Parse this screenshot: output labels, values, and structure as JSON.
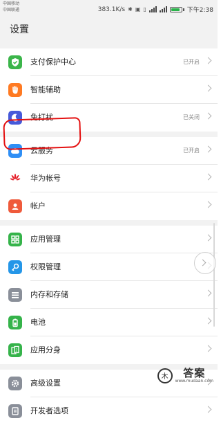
{
  "status_bar": {
    "carrier_1": "中国移动",
    "carrier_2": "中国联通",
    "speed": "383.1K/s",
    "battery_level": 0.8,
    "time": "下午2:38"
  },
  "header": {
    "title": "设置"
  },
  "groups": [
    [
      {
        "label": "支付保护中心",
        "value": "已开启",
        "icon": "shield-check-icon",
        "color": "#3bb54a"
      },
      {
        "label": "智能辅助",
        "value": "",
        "icon": "hand-icon",
        "color": "#ff7a22"
      },
      {
        "label": "免打扰",
        "value": "已关闭",
        "icon": "moon-icon",
        "color": "#4659d9"
      }
    ],
    [
      {
        "label": "云服务",
        "value": "已开启",
        "icon": "cloud-icon",
        "color": "#2f8ff5"
      },
      {
        "label": "华为帐号",
        "value": "",
        "icon": "huawei-logo-icon",
        "color": "#ffffff"
      },
      {
        "label": "帐户",
        "value": "",
        "icon": "account-icon",
        "color": "#ef5a3b"
      }
    ],
    [
      {
        "label": "应用管理",
        "value": "",
        "icon": "app-grid-icon",
        "color": "#35b34a"
      },
      {
        "label": "权限管理",
        "value": "",
        "icon": "key-icon",
        "color": "#2496e8"
      },
      {
        "label": "内存和存储",
        "value": "",
        "icon": "storage-icon",
        "color": "#8a8f99"
      },
      {
        "label": "电池",
        "value": "",
        "icon": "battery-icon",
        "color": "#35b34a"
      },
      {
        "label": "应用分身",
        "value": "",
        "icon": "app-twin-icon",
        "color": "#35b34a"
      }
    ],
    [
      {
        "label": "高级设置",
        "value": "",
        "icon": "gear-icon",
        "color": "#8a8f99"
      },
      {
        "label": "开发者选项",
        "value": "",
        "icon": "developer-icon",
        "color": "#8a8f99"
      }
    ]
  ],
  "watermark": {
    "text": "答案",
    "url": "www.mudaan.com"
  }
}
